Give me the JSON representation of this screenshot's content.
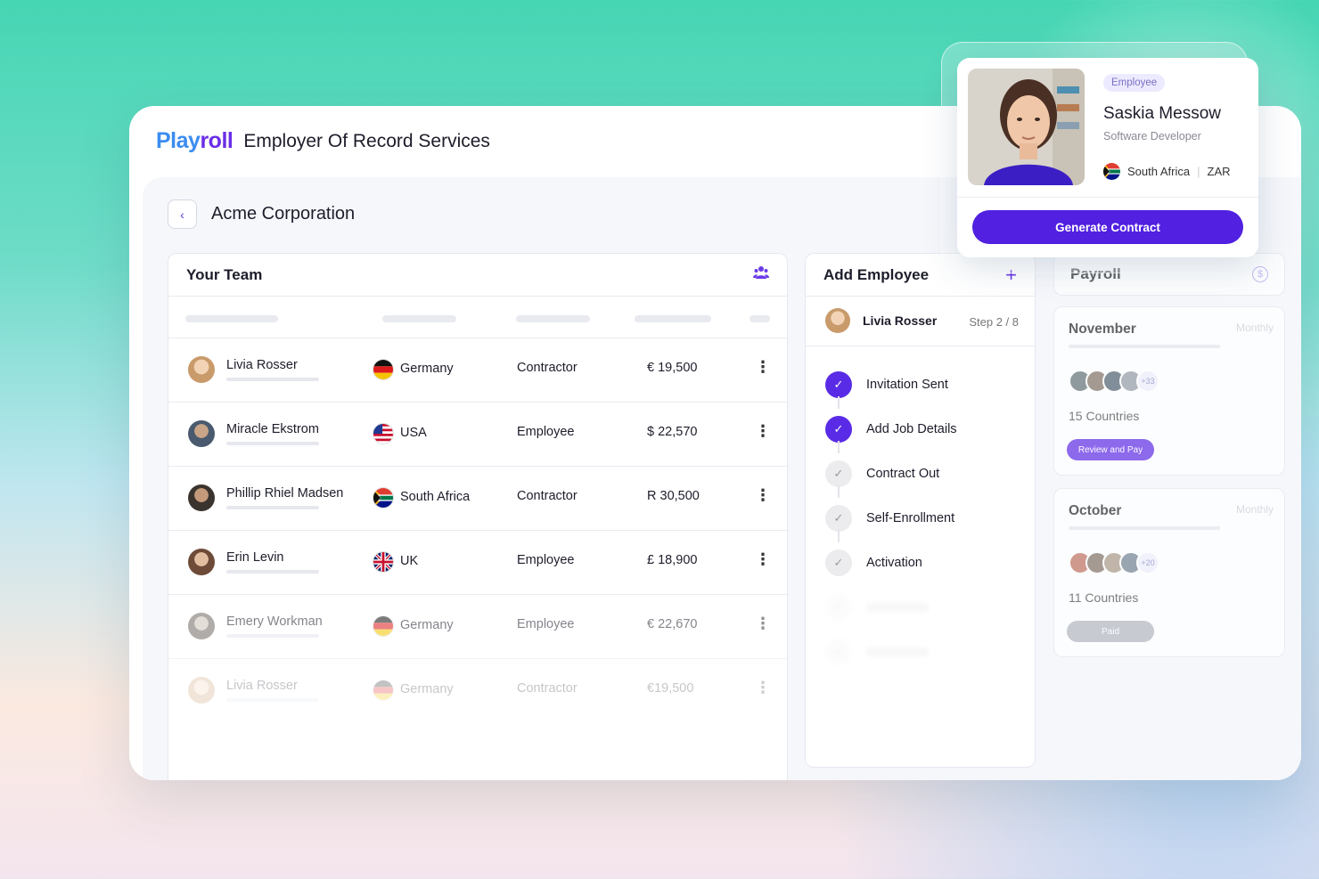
{
  "app": {
    "logo_part1": "Play",
    "logo_part2": "roll",
    "title": "Employer Of Record Services"
  },
  "company": {
    "name": "Acme Corporation",
    "back_icon": "chevron-left-icon"
  },
  "team": {
    "title": "Your Team",
    "icon": "team-icon",
    "rows": [
      {
        "name": "Livia Rosser",
        "country": "Germany",
        "flag": "de",
        "type": "Contractor",
        "salary": "€ 19,500",
        "avatar_color": "#d9b48a"
      },
      {
        "name": "Miracle Ekstrom",
        "country": "USA",
        "flag": "us",
        "type": "Employee",
        "salary": "$ 22,570",
        "avatar_color": "#6d7b8a"
      },
      {
        "name": "Phillip Rhiel Madsen",
        "country": "South Africa",
        "flag": "za",
        "type": "Contractor",
        "salary": "R 30,500",
        "avatar_color": "#5a4a40"
      },
      {
        "name": "Erin Levin",
        "country": "UK",
        "flag": "uk",
        "type": "Employee",
        "salary": "£ 18,900",
        "avatar_color": "#8a6a58"
      },
      {
        "name": "Emery Workman",
        "country": "Germany",
        "flag": "de",
        "type": "Employee",
        "salary": "€ 22,670",
        "avatar_color": "#7a7470"
      },
      {
        "name": "Livia Rosser",
        "country": "Germany",
        "flag": "de",
        "type": "Contractor",
        "salary": "€19,500",
        "avatar_color": "#d9b48a"
      }
    ]
  },
  "add_employee": {
    "title": "Add Employee",
    "plus_icon": "plus-icon",
    "employee_name": "Livia Rosser",
    "step": "Step 2 / 8",
    "steps": [
      {
        "label": "Invitation Sent",
        "done": true
      },
      {
        "label": "Add Job Details",
        "done": true
      },
      {
        "label": "Contract Out",
        "done": false
      },
      {
        "label": "Self-Enrollment",
        "done": false
      },
      {
        "label": "Activation",
        "done": false
      }
    ]
  },
  "payroll": {
    "title": "Payroll",
    "icon": "dollar-icon",
    "months": [
      {
        "name": "November",
        "tag": "Monthly",
        "more": "+33",
        "countries": "15 Countries",
        "button": "Review and Pay"
      },
      {
        "name": "October",
        "tag": "Monthly",
        "more": "+20",
        "countries": "11 Countries",
        "button": "Paid"
      }
    ]
  },
  "profile_card": {
    "badge": "Employee",
    "name": "Saskia Messow",
    "role": "Software Developer",
    "country": "South Africa",
    "currency": "ZAR",
    "button": "Generate Contract"
  },
  "colors": {
    "brand_purple": "#5120e0",
    "brand_blue": "#3b8cf0",
    "accent_teal": "#46d6b4"
  }
}
